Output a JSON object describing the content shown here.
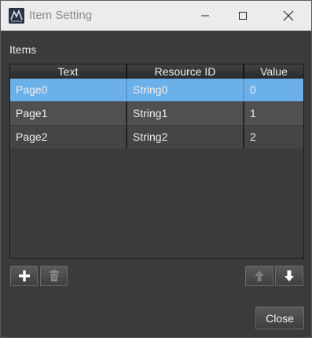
{
  "window": {
    "title": "Item Setting"
  },
  "items_label": "Items",
  "table": {
    "columns": [
      "Text",
      "Resource ID",
      "Value"
    ],
    "rows": [
      {
        "text": "Page0",
        "resource_id": "String0",
        "value": "0",
        "selected": true
      },
      {
        "text": "Page1",
        "resource_id": "String1",
        "value": "1",
        "selected": false
      },
      {
        "text": "Page2",
        "resource_id": "String2",
        "value": "2",
        "selected": false
      }
    ]
  },
  "buttons": {
    "add_icon": "plus-icon",
    "delete_icon": "trash-icon",
    "move_up_icon": "arrow-up-icon",
    "move_down_icon": "arrow-down-icon",
    "close_label": "Close"
  },
  "colors": {
    "selection": "#6cb0ea",
    "background": "#3b3b3d"
  }
}
